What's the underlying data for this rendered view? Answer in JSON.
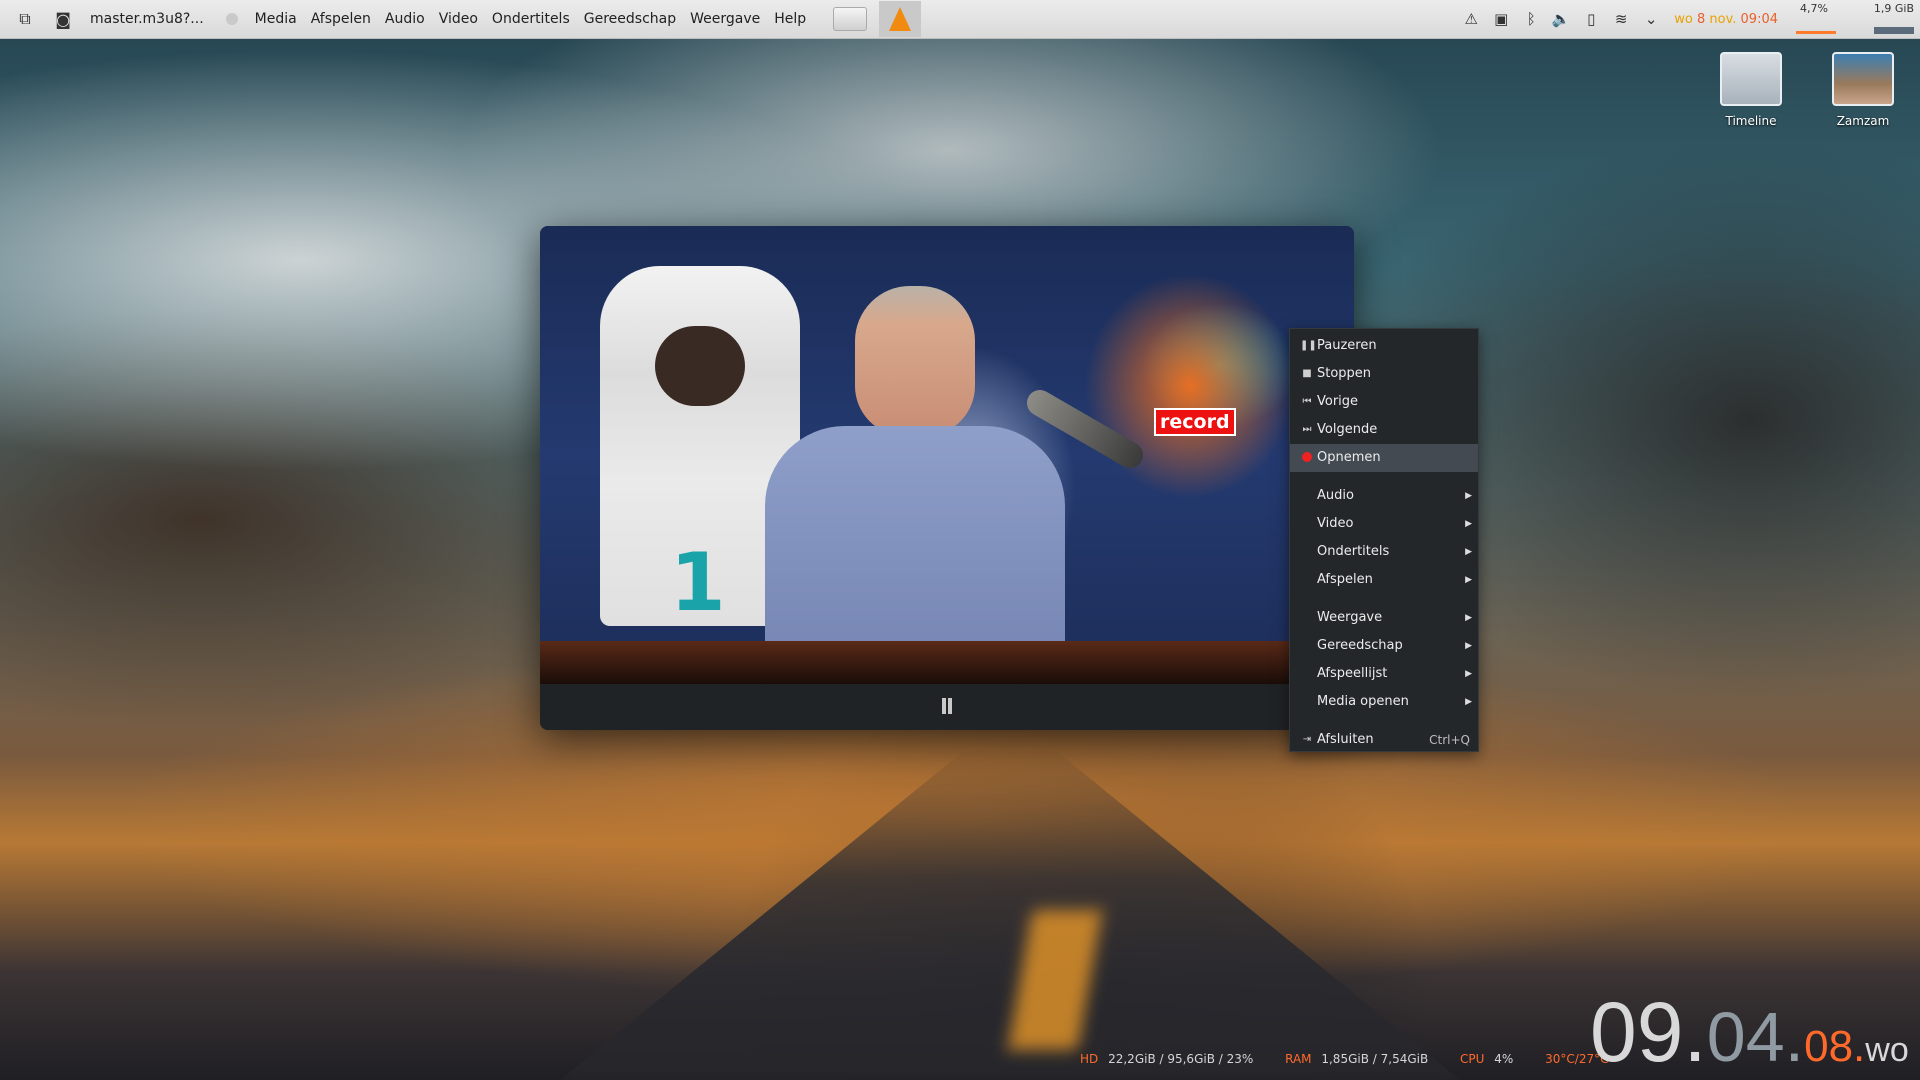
{
  "topbar": {
    "window_title": "master.m3u8?...",
    "menu": [
      "Media",
      "Afspelen",
      "Audio",
      "Video",
      "Ondertitels",
      "Gereedschap",
      "Weergave",
      "Help"
    ],
    "date_day": "wo",
    "date_num": "8",
    "date_month": "nov.",
    "time": "09:04",
    "cpu_percent": "4,7%",
    "ram_usage": "1,9 GiB"
  },
  "desktop": {
    "icons": [
      {
        "label": "Timeline"
      },
      {
        "label": "Zamzam"
      }
    ]
  },
  "vlc": {
    "overlay_label": "record"
  },
  "context_menu": {
    "items": [
      {
        "label": "Pauzeren",
        "icon": "pause-icon"
      },
      {
        "label": "Stoppen",
        "icon": "stop-icon"
      },
      {
        "label": "Vorige",
        "icon": "previous-icon"
      },
      {
        "label": "Volgende",
        "icon": "next-icon"
      },
      {
        "label": "Opnemen",
        "icon": "record-icon"
      },
      {
        "label": "Audio"
      },
      {
        "label": "Video"
      },
      {
        "label": "Ondertitels"
      },
      {
        "label": "Afspelen"
      },
      {
        "label": "Weergave"
      },
      {
        "label": "Gereedschap"
      },
      {
        "label": "Afspeellijst"
      },
      {
        "label": "Media openen"
      },
      {
        "label": "Afsluiten",
        "icon": "exit-icon",
        "shortcut": "Ctrl+Q"
      }
    ]
  },
  "system": {
    "hd_label": "HD",
    "hd_value": "22,2GiB / 95,6GiB / 23%",
    "ram_label": "RAM",
    "ram_value": "1,85GiB / 7,54GiB",
    "cpu_label": "CPU",
    "cpu_value": "4%",
    "temp_value": "30°C/27°C"
  },
  "clock": {
    "hours": "09.",
    "minutes": "04.",
    "seconds": "08.",
    "weekday": "wo"
  },
  "colors": {
    "accent": "#ff6a2a",
    "record_red": "#ee1111",
    "menu_bg": "#24272a"
  }
}
